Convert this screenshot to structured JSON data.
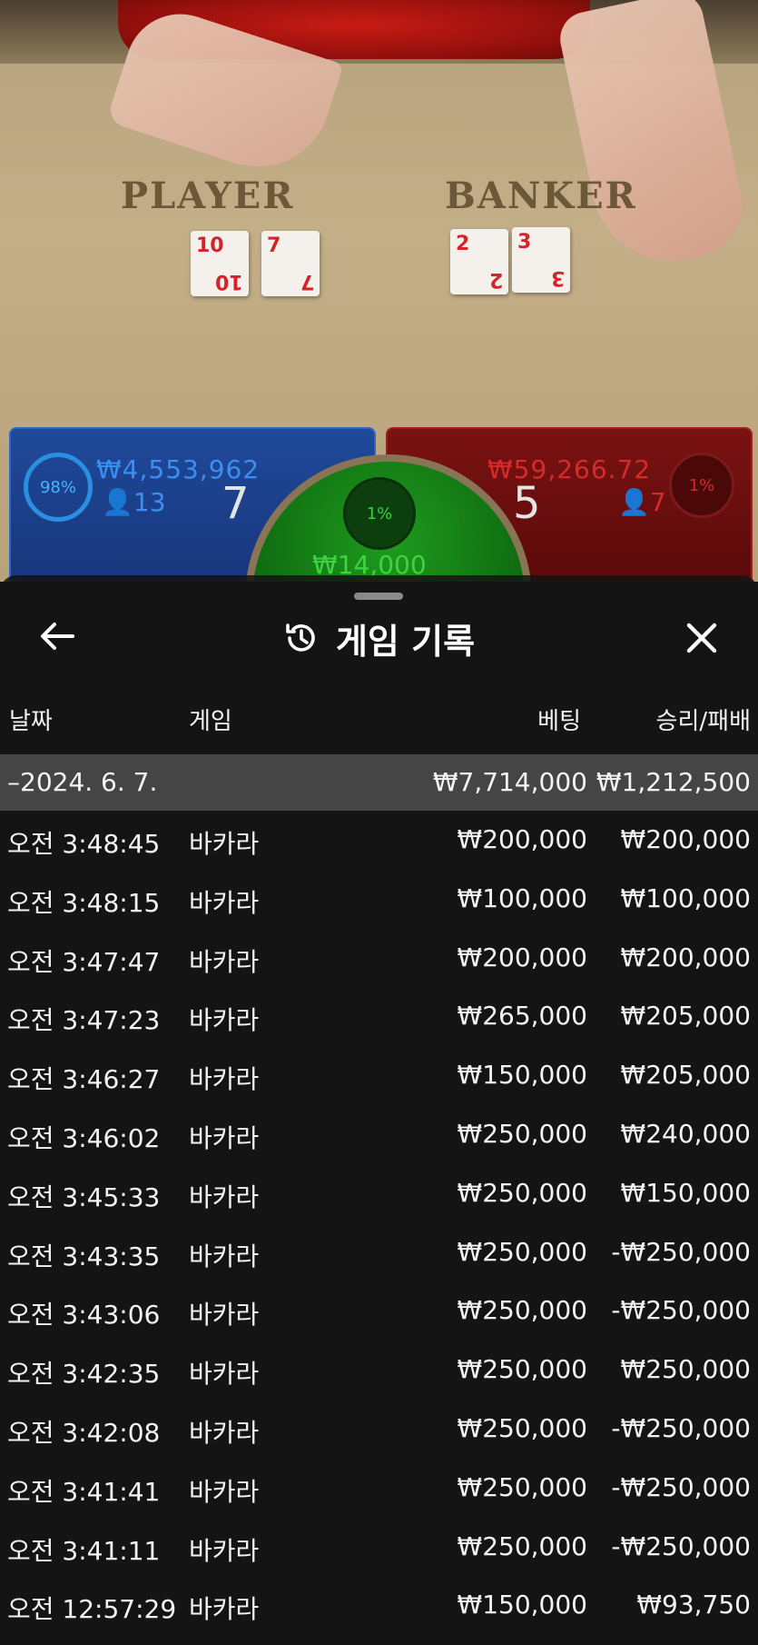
{
  "table": {
    "player_label": "PLAYER",
    "banker_label": "BANKER",
    "player_cards": [
      {
        "rank": "10",
        "suit": "♥"
      },
      {
        "rank": "7",
        "suit": "♦"
      }
    ],
    "banker_cards": [
      {
        "rank": "2",
        "suit": "♦"
      },
      {
        "rank": "3",
        "suit": "♥"
      }
    ]
  },
  "bets": {
    "player": {
      "percent": "98%",
      "amount": "₩4,553,962",
      "players": "13",
      "score": "7"
    },
    "banker": {
      "percent": "1%",
      "amount": "₩59,266.72",
      "players": "7",
      "score": "5"
    },
    "tie": {
      "percent": "1%",
      "amount": "₩14,000"
    }
  },
  "sheet": {
    "title": "게임 기록",
    "columns": {
      "date": "날짜",
      "game": "게임",
      "bet": "베팅",
      "result": "승리/패배"
    },
    "summary": {
      "date": "–2024. 6. 7.",
      "bet": "₩7,714,000",
      "result": "₩1,212,500"
    },
    "rows": [
      {
        "time": "오전 3:48:45",
        "game": "바카라",
        "bet": "₩200,000",
        "result": "₩200,000"
      },
      {
        "time": "오전 3:48:15",
        "game": "바카라",
        "bet": "₩100,000",
        "result": "₩100,000"
      },
      {
        "time": "오전 3:47:47",
        "game": "바카라",
        "bet": "₩200,000",
        "result": "₩200,000"
      },
      {
        "time": "오전 3:47:23",
        "game": "바카라",
        "bet": "₩265,000",
        "result": "₩205,000"
      },
      {
        "time": "오전 3:46:27",
        "game": "바카라",
        "bet": "₩150,000",
        "result": "₩205,000"
      },
      {
        "time": "오전 3:46:02",
        "game": "바카라",
        "bet": "₩250,000",
        "result": "₩240,000"
      },
      {
        "time": "오전 3:45:33",
        "game": "바카라",
        "bet": "₩250,000",
        "result": "₩150,000"
      },
      {
        "time": "오전 3:43:35",
        "game": "바카라",
        "bet": "₩250,000",
        "result": "-₩250,000"
      },
      {
        "time": "오전 3:43:06",
        "game": "바카라",
        "bet": "₩250,000",
        "result": "-₩250,000"
      },
      {
        "time": "오전 3:42:35",
        "game": "바카라",
        "bet": "₩250,000",
        "result": "₩250,000"
      },
      {
        "time": "오전 3:42:08",
        "game": "바카라",
        "bet": "₩250,000",
        "result": "-₩250,000"
      },
      {
        "time": "오전 3:41:41",
        "game": "바카라",
        "bet": "₩250,000",
        "result": "-₩250,000"
      },
      {
        "time": "오전 3:41:11",
        "game": "바카라",
        "bet": "₩250,000",
        "result": "-₩250,000"
      },
      {
        "time": "오전 12:57:29",
        "game": "바카라",
        "bet": "₩150,000",
        "result": "₩93,750"
      }
    ]
  },
  "icons": {
    "back": "arrow-left-icon",
    "history": "history-icon",
    "close": "close-icon",
    "user": "user-icon"
  },
  "colors": {
    "player_blue": "#2f66c4",
    "banker_red": "#a21d1d",
    "tie_green": "#1e9b1e",
    "sheet_bg": "#141414"
  }
}
